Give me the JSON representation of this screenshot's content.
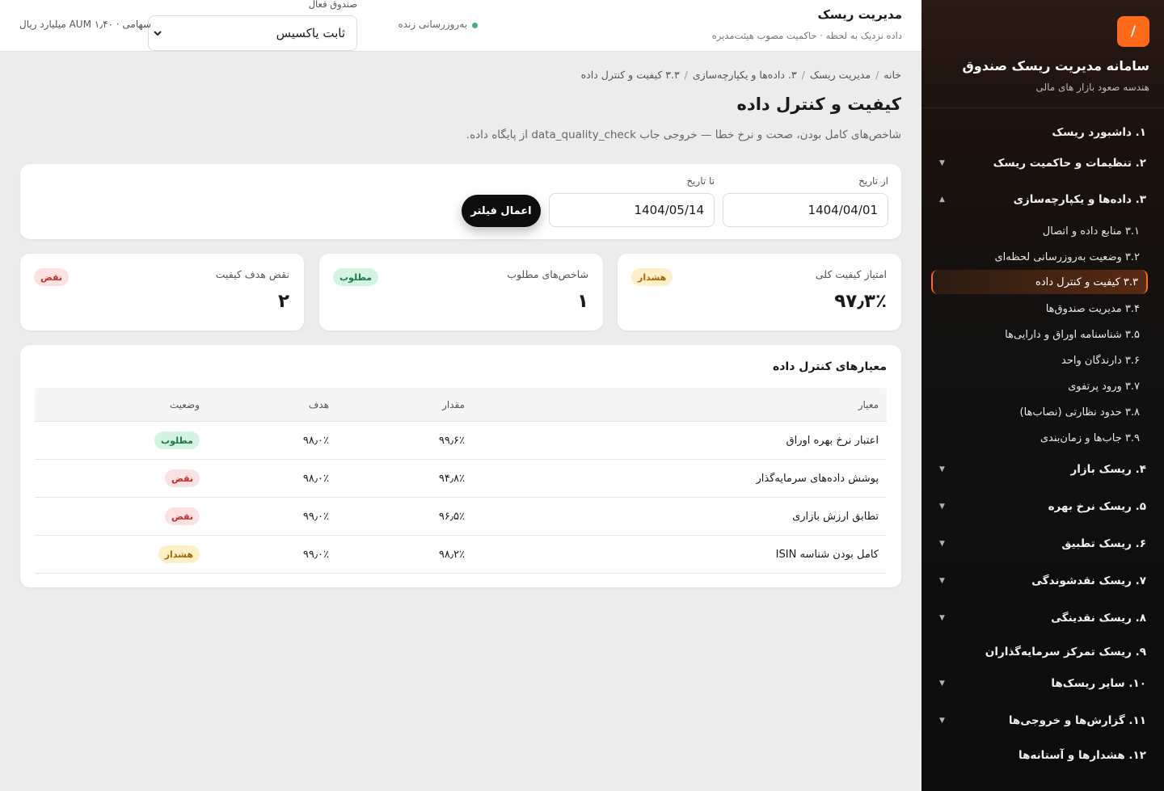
{
  "sidebar": {
    "logo_glyph": "/",
    "title": "سامانه مدیریت ریسک صندوق",
    "subtitle": "هندسه صعود بازار های مالی",
    "items": [
      {
        "label": "۱. داشبورد ریسک"
      },
      {
        "label": "۲. تنظیمات و حاکمیت ریسک"
      },
      {
        "label": "۳. داده‌ها و یکپارچه‌سازی"
      },
      {
        "label": "۴. ریسک بازار"
      },
      {
        "label": "۵. ریسک نرخ بهره"
      },
      {
        "label": "۶. ریسک تطبیق"
      },
      {
        "label": "۷. ریسک نقدشوندگی"
      },
      {
        "label": "۸. ریسک نقدینگی"
      },
      {
        "label": "۹. ریسک تمرکز سرمایه‌گذاران"
      },
      {
        "label": "۱۰. سایر ریسک‌ها"
      },
      {
        "label": "۱۱. گزارش‌ها و خروجی‌ها"
      },
      {
        "label": "۱۲. هشدارها و آستانه‌ها"
      }
    ],
    "subitems": [
      {
        "label": "۳.۱ منابع داده و اتصال"
      },
      {
        "label": "۳.۲ وضعیت به‌روزرسانی لحظه‌ای"
      },
      {
        "label": "۳.۳ کیفیت و کنترل داده"
      },
      {
        "label": "۳.۴ مدیریت صندوق‌ها"
      },
      {
        "label": "۳.۵ شناسنامه اوراق و دارایی‌ها"
      },
      {
        "label": "۳.۶ دارندگان واحد"
      },
      {
        "label": "۳.۷ ورود پرتفوی"
      },
      {
        "label": "۳.۸ حدود نظارتی (نصاب‌ها)"
      },
      {
        "label": "۳.۹ جاب‌ها و زمان‌بندی"
      }
    ],
    "caret_down": "▼",
    "caret_up": "▲"
  },
  "topbar": {
    "title": "مدیریت ریسک",
    "subtitle": "داده نزدیک به لحظه · حاکمیت مصوب هیئت‌مدیره",
    "live_label": "به‌روزرسانی زنده",
    "fund_label": "صندوق فعال",
    "fund_value": "ثابت یاکسیس",
    "aum": "سهامی · AUM ۱٫۴۰ میلیارد ریال"
  },
  "breadcrumb": [
    "خانه",
    "مدیریت ریسک",
    "۳. داده‌ها و یکپارچه‌سازی",
    "۳.۳ کیفیت و کنترل داده"
  ],
  "page": {
    "title": "کیفیت و کنترل داده",
    "description": "شاخص‌های کامل بودن، صحت و نرخ خطا — خروجی جاب data_quality_check از پایگاه داده."
  },
  "filter": {
    "from_label": "از تاریخ",
    "from_value": "1404/04/01",
    "to_label": "تا تاریخ",
    "to_value": "1404/05/14",
    "apply_label": "اعمال فیلتر"
  },
  "kpis": [
    {
      "label": "امتیاز کیفیت کلی",
      "value": "۹۷٫۳٪",
      "badge": "هشدار",
      "status": "warn"
    },
    {
      "label": "شاخص‌های مطلوب",
      "value": "۱",
      "badge": "مطلوب",
      "status": "ok"
    },
    {
      "label": "نقض هدف کیفیت",
      "value": "۲",
      "badge": "نقض",
      "status": "bad"
    }
  ],
  "table": {
    "title": "معیارهای کنترل داده",
    "headers": {
      "name": "معیار",
      "value": "مقدار",
      "target": "هدف",
      "status": "وضعیت"
    },
    "rows": [
      {
        "name": "اعتبار نرخ بهره اوراق",
        "value": "۹۹٫۶٪",
        "target": "۹۸٫۰٪",
        "status": "مطلوب",
        "status_type": "ok"
      },
      {
        "name": "پوشش داده‌های سرمایه‌گذار",
        "value": "۹۴٫۸٪",
        "target": "۹۸٫۰٪",
        "status": "نقض",
        "status_type": "bad"
      },
      {
        "name": "تطابق ارزش بازاری",
        "value": "۹۶٫۵٪",
        "target": "۹۹٫۰٪",
        "status": "نقض",
        "status_type": "bad"
      },
      {
        "name": "کامل بودن شناسه ISIN",
        "value": "۹۸٫۲٪",
        "target": "۹۹٫۰٪",
        "status": "هشدار",
        "status_type": "warn"
      }
    ]
  }
}
